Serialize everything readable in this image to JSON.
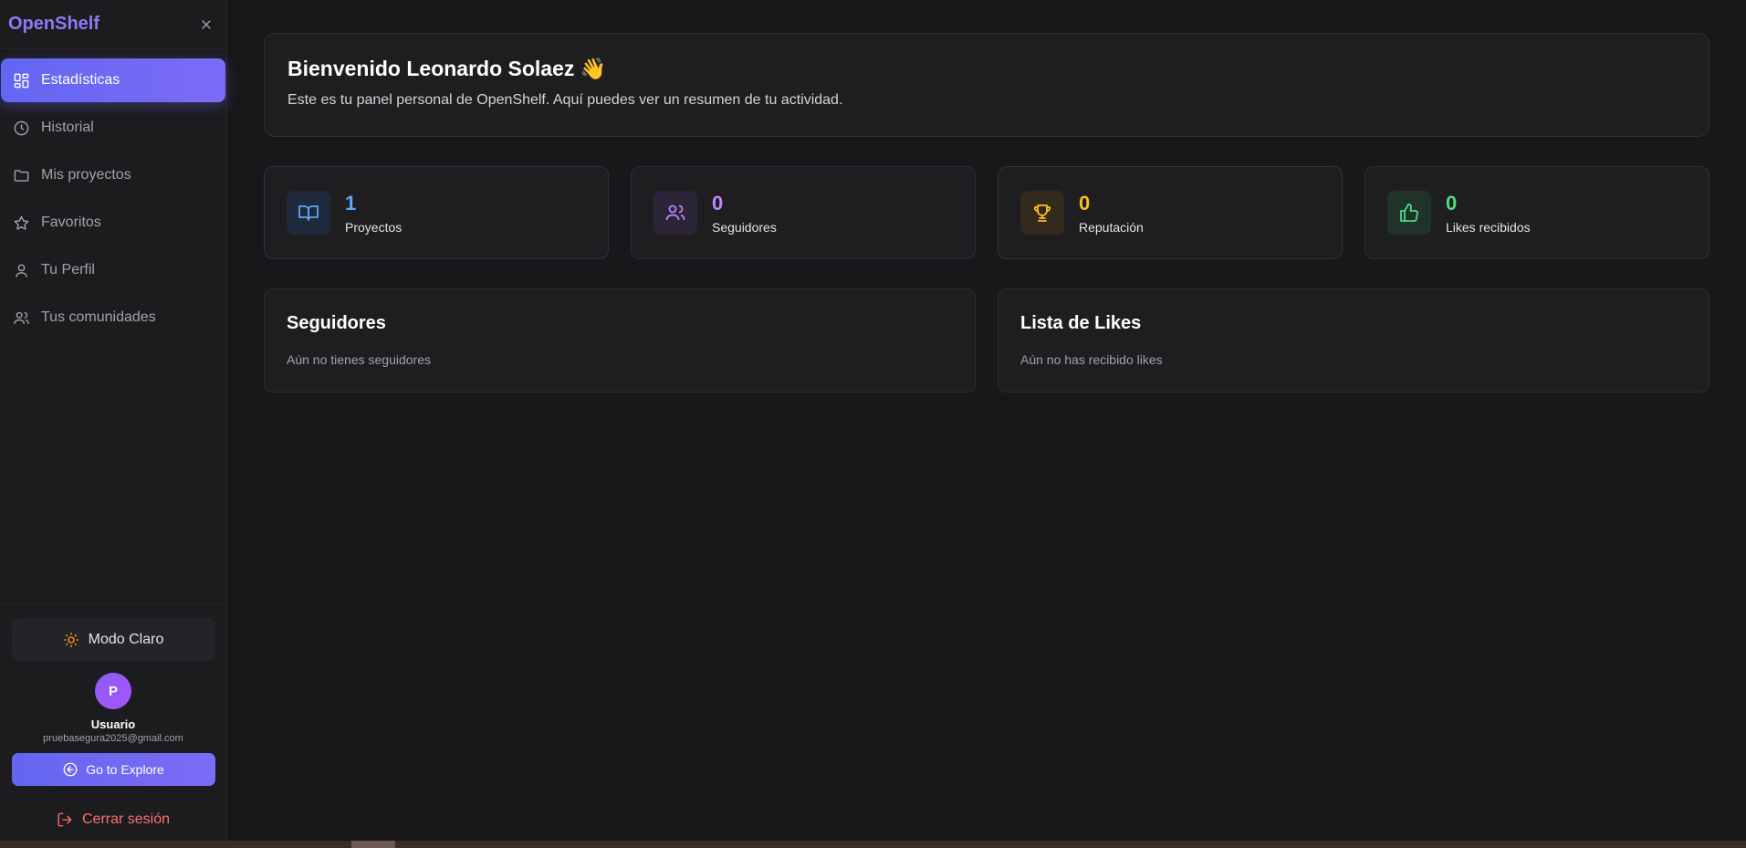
{
  "sidebar": {
    "brand": "OpenShelf",
    "items": [
      {
        "label": "Estadísticas",
        "icon": "dashboard-icon",
        "active": true
      },
      {
        "label": "Historial",
        "icon": "clock-icon"
      },
      {
        "label": "Mis proyectos",
        "icon": "folder-icon"
      },
      {
        "label": "Favoritos",
        "icon": "star-icon"
      },
      {
        "label": "Tu Perfil",
        "icon": "user-icon"
      },
      {
        "label": "Tus comunidades",
        "icon": "users-icon"
      }
    ],
    "theme_label": "Modo Claro",
    "avatar_initial": "P",
    "user_name": "Usuario",
    "user_email": "pruebasegura2025@gmail.com",
    "explore_label": "Go to Explore",
    "logout_label": "Cerrar sesión"
  },
  "welcome": {
    "title": "Bienvenido Leonardo Solaez 👋",
    "subtitle": "Este es tu panel personal de OpenShelf. Aquí puedes ver un resumen de tu actividad."
  },
  "stats": [
    {
      "value": "1",
      "label": "Proyectos",
      "icon": "book-icon",
      "color": "#60a5fa"
    },
    {
      "value": "0",
      "label": "Seguidores",
      "icon": "users-icon",
      "color": "#c084fc"
    },
    {
      "value": "0",
      "label": "Reputación",
      "icon": "trophy-icon",
      "color": "#fbbf24"
    },
    {
      "value": "0",
      "label": "Likes recibidos",
      "icon": "thumbs-up-icon",
      "color": "#4ade80"
    }
  ],
  "followers": {
    "title": "Seguidores",
    "empty": "Aún no tienes seguidores"
  },
  "likes": {
    "title": "Lista de Likes",
    "empty": "Aún no has recibido likes"
  }
}
